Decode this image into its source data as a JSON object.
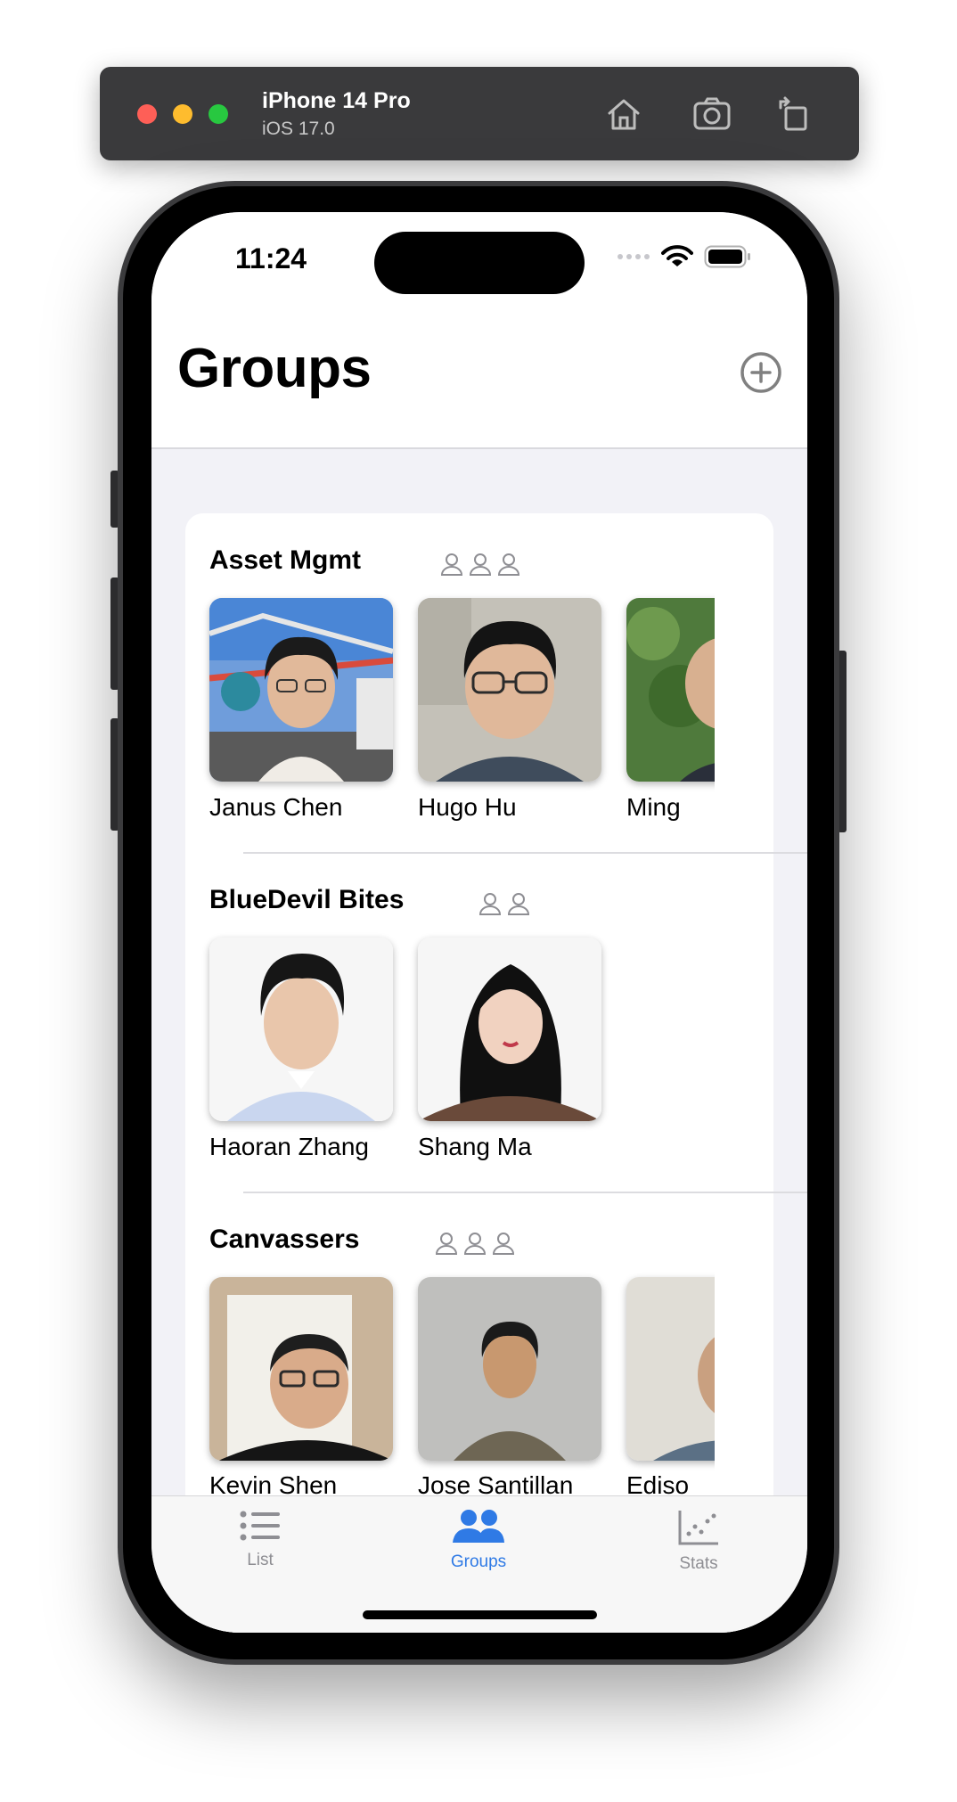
{
  "simulator": {
    "device_name": "iPhone 14 Pro",
    "os_version": "iOS 17.0",
    "toolbar_icons": [
      "home-icon",
      "screenshot-icon",
      "rotate-icon"
    ]
  },
  "status_bar": {
    "time": "11:24",
    "icons": [
      "cellular-icon",
      "wifi-icon",
      "battery-icon"
    ]
  },
  "header": {
    "title": "Groups",
    "add_icon": "plus-circle-icon"
  },
  "groups": [
    {
      "title": "Asset Mgmt",
      "member_icon_count": 3,
      "members": [
        {
          "name": "Janus Chen"
        },
        {
          "name": "Hugo Hu"
        },
        {
          "name": "Ming"
        }
      ]
    },
    {
      "title": "BlueDevil Bites",
      "member_icon_count": 2,
      "members": [
        {
          "name": "Haoran Zhang"
        },
        {
          "name": "Shang Ma"
        }
      ]
    },
    {
      "title": "Canvassers",
      "member_icon_count": 3,
      "members": [
        {
          "name": "Kevin Shen"
        },
        {
          "name": "Jose Santillan"
        },
        {
          "name": "Ediso"
        }
      ]
    }
  ],
  "tab_bar": {
    "tabs": [
      {
        "label": "List",
        "icon": "list-icon",
        "selected": false
      },
      {
        "label": "Groups",
        "icon": "people-icon",
        "selected": true
      },
      {
        "label": "Stats",
        "icon": "chart-icon",
        "selected": false
      }
    ],
    "accent_color": "#2f7ae5",
    "inactive_color": "#8e8e93"
  }
}
